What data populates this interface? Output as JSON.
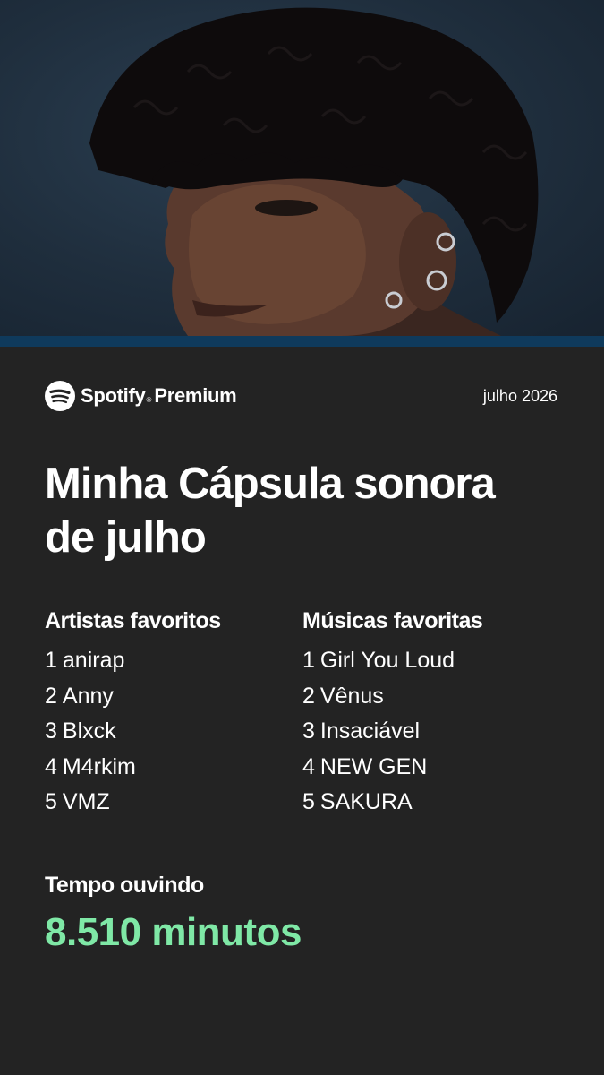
{
  "header": {
    "brand_name": "Spotify",
    "brand_tm": "®",
    "brand_tier": "Premium",
    "date": "julho 2026"
  },
  "title_line1": "Minha Cápsula sonora",
  "title_line2": "de julho",
  "artists": {
    "heading": "Artistas favoritos",
    "items": [
      {
        "rank": "1",
        "name": "anirap"
      },
      {
        "rank": "2",
        "name": "Anny"
      },
      {
        "rank": "3",
        "name": "Blxck"
      },
      {
        "rank": "4",
        "name": "M4rkim"
      },
      {
        "rank": "5",
        "name": "VMZ"
      }
    ]
  },
  "songs": {
    "heading": "Músicas favoritas",
    "items": [
      {
        "rank": "1",
        "name": "Girl You Loud"
      },
      {
        "rank": "2",
        "name": "Vênus"
      },
      {
        "rank": "3",
        "name": "Insaciável"
      },
      {
        "rank": "4",
        "name": "NEW GEN"
      },
      {
        "rank": "5",
        "name": "SAKURA"
      }
    ]
  },
  "listening": {
    "label": "Tempo ouvindo",
    "value": "8.510 minutos"
  },
  "colors": {
    "background": "#232323",
    "accent_green": "#7fe8a6",
    "photo_bar": "#0f3a5c"
  },
  "icons": {
    "brand": "spotify-logo-icon"
  }
}
